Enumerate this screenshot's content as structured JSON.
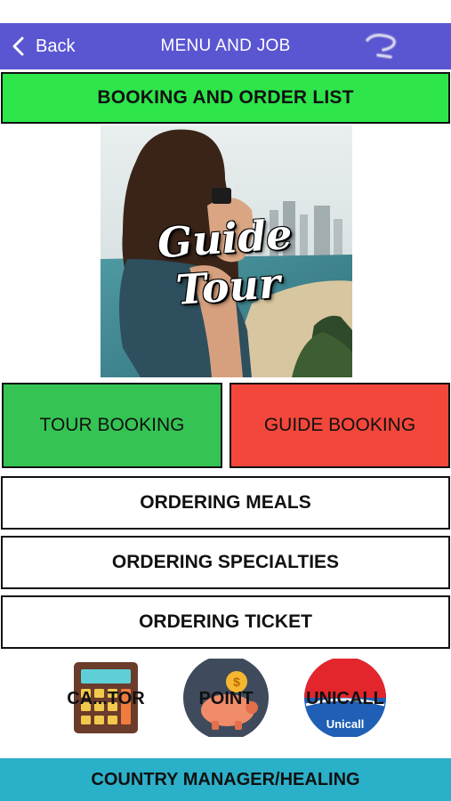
{
  "nav": {
    "back_label": "Back",
    "title": "MENU AND JOB",
    "help_icon": "question-icon"
  },
  "booking_list": {
    "label": "BOOKING AND ORDER LIST"
  },
  "hero": {
    "title": "Guide Tour"
  },
  "buttons": {
    "tour_booking": "TOUR BOOKING",
    "guide_booking": "GUIDE BOOKING",
    "ordering_meals": "ORDERING MEALS",
    "ordering_specialties": "ORDERING SPECIALTIES",
    "ordering_ticket": "ORDERING TICKET"
  },
  "icons": {
    "calculator": {
      "label": "CA...TOR",
      "icon": "calculator-icon"
    },
    "point": {
      "label": "POINT",
      "icon": "piggy-bank-icon"
    },
    "unicall": {
      "label": "UNICALL",
      "logo_text": "Unicall",
      "icon": "unicall-logo-icon"
    }
  },
  "footer": {
    "label": "COUNTRY MANAGER/HEALING"
  },
  "colors": {
    "nav": "#5a55d1",
    "booking_list": "#2ee64a",
    "tour_booking": "#35c454",
    "guide_booking": "#f4473b",
    "footer": "#2bb0c9"
  }
}
